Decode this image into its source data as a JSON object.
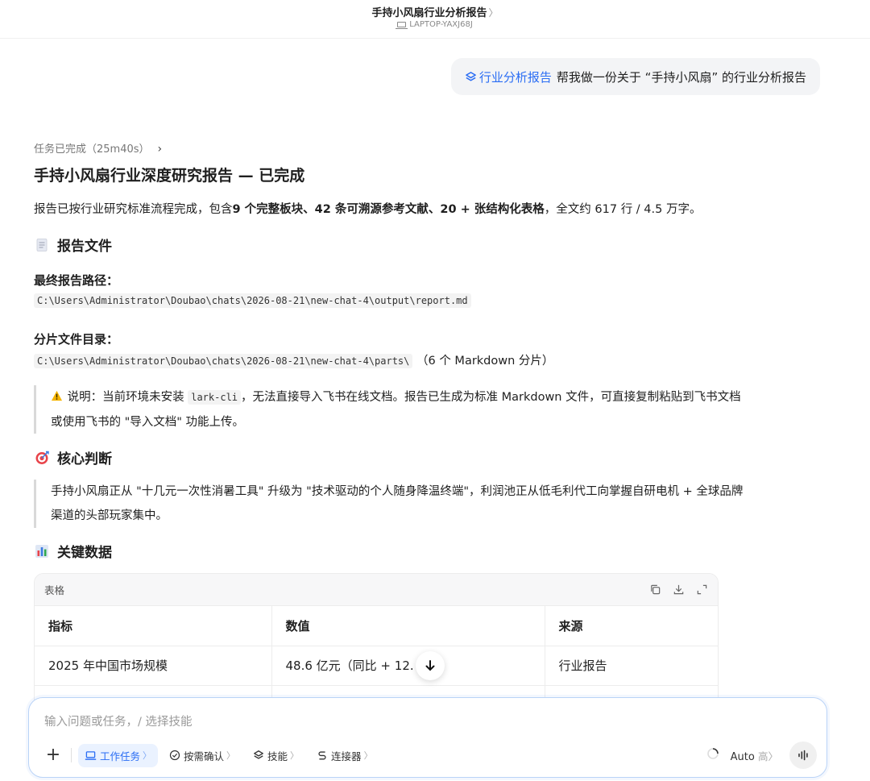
{
  "header": {
    "title": "手持小风扇行业分析报告",
    "device": "LAPTOP-YAXJ68J"
  },
  "user_message": {
    "skill_tag": "行业分析报告",
    "text": "帮我做一份关于 “手持小风扇” 的行业分析报告"
  },
  "response": {
    "task_status": "任务已完成（25m40s）",
    "title": "手持小风扇行业深度研究报告 — 已完成",
    "summary": {
      "prefix": "报告已按行业研究标准流程完成，包含",
      "bold": "9 个完整板块、42 条可溯源参考文献、20 + 张结构化表格",
      "suffix": "，全文约 617 行 / 4.5 万字。"
    },
    "report_files": {
      "heading": "报告文件",
      "final_path_label": "最终报告路径：",
      "final_path": "C:\\Users\\Administrator\\Doubao\\chats\\2026-08-21\\new-chat-4\\output\\report.md",
      "parts_label": "分片文件目录：",
      "parts_path": "C:\\Users\\Administrator\\Doubao\\chats\\2026-08-21\\new-chat-4\\parts\\",
      "parts_note": "（6 个 Markdown 分片）"
    },
    "notice": {
      "prefix": "说明：当前环境未安装",
      "code": "lark-cli",
      "line1_suffix": "，无法直接导入飞书在线文档。报告已生成为标准 Markdown 文件，可直接复制粘贴到飞书文档",
      "line2": "或使用飞书的 \"导入文档\" 功能上传。"
    },
    "core": {
      "heading": "核心判断",
      "line1": "手持小风扇正从 \"十几元一次性消暑工具\" 升级为 \"技术驱动的个人随身降温终端\"，利润池正从低毛利代工向掌握自研电机 + 全球品牌",
      "line2": "渠道的头部玩家集中。"
    },
    "key_data": {
      "heading": "关键数据",
      "table_label": "表格",
      "columns": [
        "指标",
        "数值",
        "来源"
      ],
      "rows": [
        [
          "2025 年中国市场规模",
          "48.6 亿元（同比 + 12.",
          "行业报告"
        ]
      ]
    }
  },
  "composer": {
    "placeholder": "输入问题或任务，/ 选择技能",
    "chips": {
      "work_task": "工作任务",
      "confirm": "按需确认",
      "skills": "技能",
      "connectors": "连接器"
    },
    "model": "Auto",
    "model_level": "高"
  },
  "colors": {
    "accent": "#2a6df4",
    "bubble_bg": "#f3f4f6",
    "quote_border": "#d9d9d9"
  }
}
